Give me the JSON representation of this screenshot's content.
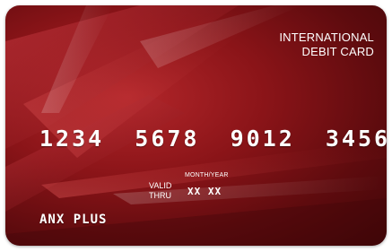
{
  "card": {
    "title_line1": "INTERNATIONAL",
    "title_line2": "DEBIT CARD",
    "number_groups": [
      "1234",
      "5678",
      "9012",
      "3456"
    ],
    "valid_line1": "VALID",
    "valid_line2": "THRU",
    "expiry_caption": "MONTH/YEAR",
    "expiry_value": "XX XX",
    "holder_name": "ANX PLUS"
  },
  "colors": {
    "card_base": "#8a1418",
    "card_dark": "#3f0608",
    "card_highlight": "#b3262a",
    "text": "#ffffff"
  }
}
